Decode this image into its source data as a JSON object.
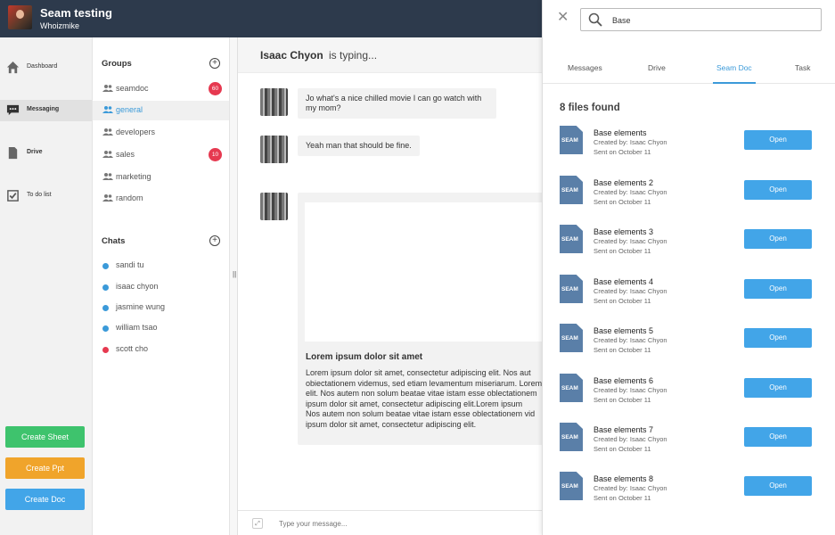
{
  "header": {
    "title": "Seam testing",
    "username": "Whoizmike"
  },
  "nav": [
    {
      "label": "Dashboard",
      "icon": "home-icon"
    },
    {
      "label": "Messaging",
      "icon": "chat-bubble-icon"
    },
    {
      "label": "Drive",
      "icon": "file-icon"
    },
    {
      "label": "To do list",
      "icon": "checkbox-icon"
    }
  ],
  "create_buttons": [
    {
      "label": "Create Sheet",
      "color": "#3ec36d"
    },
    {
      "label": "Create Ppt",
      "color": "#f0a42b"
    },
    {
      "label": "Create Doc",
      "color": "#42a5e8"
    }
  ],
  "groups": {
    "title": "Groups",
    "items": [
      {
        "label": "seamdoc",
        "badge": "60"
      },
      {
        "label": "general"
      },
      {
        "label": "developers"
      },
      {
        "label": "sales",
        "badge": "10"
      },
      {
        "label": "marketing"
      },
      {
        "label": "random"
      }
    ]
  },
  "chats": {
    "title": "Chats",
    "items": [
      {
        "label": "sandi tu",
        "status_color": "#3b9ad9"
      },
      {
        "label": "isaac chyon",
        "status_color": "#3b9ad9"
      },
      {
        "label": "jasmine wung",
        "status_color": "#3b9ad9"
      },
      {
        "label": "william tsao",
        "status_color": "#3b9ad9"
      },
      {
        "label": "scott cho",
        "status_color": "#e63950"
      }
    ]
  },
  "conversation": {
    "contact_name": "Isaac Chyon",
    "typing_text": "is typing...",
    "messages": [
      "Jo what's a nice chilled movie I can go watch with\nmy mom?",
      "Yeah man that should be fine."
    ],
    "card": {
      "title": "Lorem ipsum dolor sit amet",
      "body": "Lorem ipsum dolor sit amet, consectetur adipiscing elit. Nos aut\nobiectationem videmus, sed etiam levamentum miseriarum. Lorem\nelit. Nos autem non solum beatae vitae istam esse oblectationem\nipsum dolor sit amet, consectetur adipiscing elit.Lorem ipsum\nNos autem non solum beatae vitae istam esse oblectationem vid\nipsum dolor sit amet, consectetur adipiscing elit."
    },
    "composer_placeholder": "Type your message..."
  },
  "search": {
    "query": "Base",
    "tabs": [
      "Messages",
      "Drive",
      "Seam Doc",
      "Task"
    ],
    "active_tab": "Seam Doc",
    "results_count_text": "8 files found",
    "file_icon_label": "SEAM",
    "results": [
      {
        "name": "Base elements",
        "created_by": "Created by: Isaac Chyon",
        "sent": "Sent on October 11",
        "action": "Open"
      },
      {
        "name": "Base elements 2",
        "created_by": "Created by: Isaac Chyon",
        "sent": "Sent on October 11",
        "action": "Open"
      },
      {
        "name": "Base elements 3",
        "created_by": "Created by: Isaac Chyon",
        "sent": "Sent on October 11",
        "action": "Open"
      },
      {
        "name": "Base elements 4",
        "created_by": "Created by: Isaac Chyon",
        "sent": "Sent on October 11",
        "action": "Open"
      },
      {
        "name": "Base elements 5",
        "created_by": "Created by: Isaac Chyon",
        "sent": "Sent on October 11",
        "action": "Open"
      },
      {
        "name": "Base elements 6",
        "created_by": "Created by: Isaac Chyon",
        "sent": "Sent on October 11",
        "action": "Open"
      },
      {
        "name": "Base elements 7",
        "created_by": "Created by: Isaac Chyon",
        "sent": "Sent on October 11",
        "action": "Open"
      },
      {
        "name": "Base elements 8",
        "created_by": "Created by: Isaac Chyon",
        "sent": "Sent on October 11",
        "action": "Open"
      }
    ]
  },
  "colors": {
    "topbar": "#2d3a4c",
    "accent": "#3b9ad9",
    "badge": "#e63950"
  }
}
